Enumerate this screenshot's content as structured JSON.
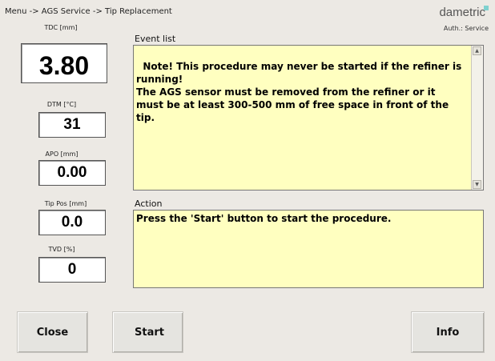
{
  "header": {
    "breadcrumb": "Menu -> AGS Service -> Tip Replacement",
    "brand": "dametric",
    "auth": "Auth.: Service"
  },
  "meters": [
    {
      "label": "TDC [mm]",
      "value": "3.80"
    },
    {
      "label": "DTM [°C]",
      "value": "31"
    },
    {
      "label": "APO [mm]",
      "value": "0.00"
    },
    {
      "label": "Tip Pos [mm]",
      "value": "0.0"
    },
    {
      "label": "TVD [%]",
      "value": "0"
    }
  ],
  "event_list": {
    "label": "Event list",
    "text": "Note! This procedure may never be started if the refiner is running!\nThe AGS sensor must be removed from the refiner or it must be at least 300-500 mm of free space in front of the tip."
  },
  "action": {
    "label": "Action",
    "text": "Press the 'Start' button to start the procedure."
  },
  "buttons": {
    "close": "Close",
    "start": "Start",
    "info": "Info"
  },
  "colors": {
    "background": "#ece9e4",
    "textbox_background": "#ffffc0",
    "brand_accent": "#7fd1cf"
  }
}
